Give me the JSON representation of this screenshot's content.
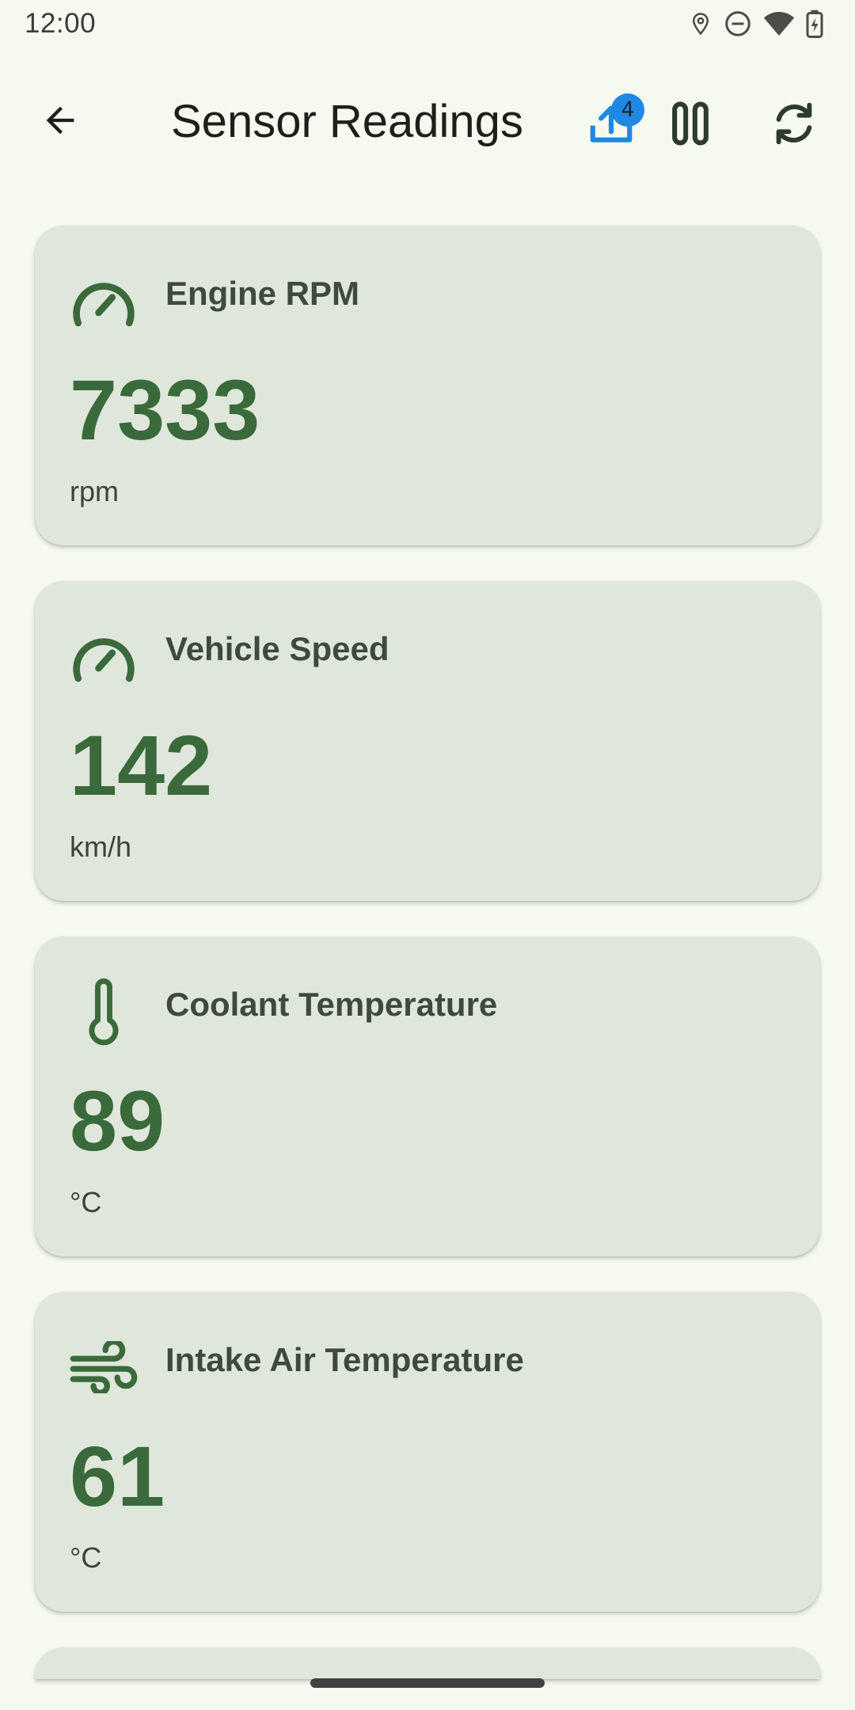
{
  "status_bar": {
    "time": "12:00",
    "icons": [
      "location-icon",
      "do-not-disturb-icon",
      "wifi-icon",
      "battery-charging-icon"
    ]
  },
  "app_bar": {
    "back_icon": "arrow-back-icon",
    "title": "Sensor Readings",
    "upload_badge_count": "4",
    "actions": [
      "upload-icon",
      "pause-icon",
      "refresh-icon"
    ]
  },
  "colors": {
    "background": "#f6f9f0",
    "card": "#dfe6da",
    "accent_green": "#3a6a3b",
    "upload_blue": "#1e88e5"
  },
  "sensors": [
    {
      "icon": "speedometer-icon",
      "label": "Engine RPM",
      "value": "7333",
      "unit": "rpm"
    },
    {
      "icon": "speedometer-icon",
      "label": "Vehicle Speed",
      "value": "142",
      "unit": "km/h"
    },
    {
      "icon": "thermometer-icon",
      "label": "Coolant Temperature",
      "value": "89",
      "unit": "°C"
    },
    {
      "icon": "air-icon",
      "label": "Intake Air Temperature",
      "value": "61",
      "unit": "°C"
    }
  ]
}
